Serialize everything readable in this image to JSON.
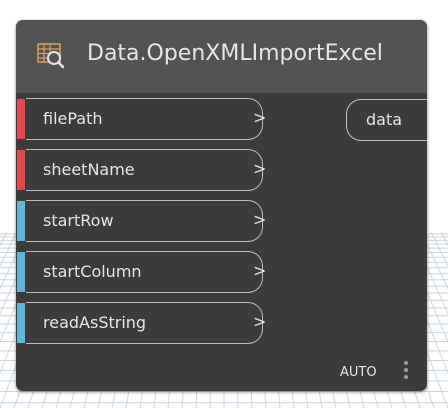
{
  "node": {
    "title": "Data.OpenXMLImportExcel",
    "icon": "spreadsheet-import-icon",
    "inputs": [
      {
        "label": "filePath",
        "arrow": ">",
        "status_color": "#e04a4f"
      },
      {
        "label": "sheetName",
        "arrow": ">",
        "status_color": "#e04a4f"
      },
      {
        "label": "startRow",
        "arrow": ">",
        "status_color": "#5fb7dd"
      },
      {
        "label": "startColumn",
        "arrow": ">",
        "status_color": "#5fb7dd"
      },
      {
        "label": "readAsString",
        "arrow": ">",
        "status_color": "#5fb7dd"
      }
    ],
    "output": {
      "label": "data"
    },
    "lacing": "AUTO"
  },
  "colors": {
    "node_body": "#3b3b3b",
    "node_header": "#535353",
    "text": "#e6e6e6",
    "port_border": "#bdbdbd",
    "required_port": "#e04a4f",
    "optional_port": "#5fb7dd"
  }
}
